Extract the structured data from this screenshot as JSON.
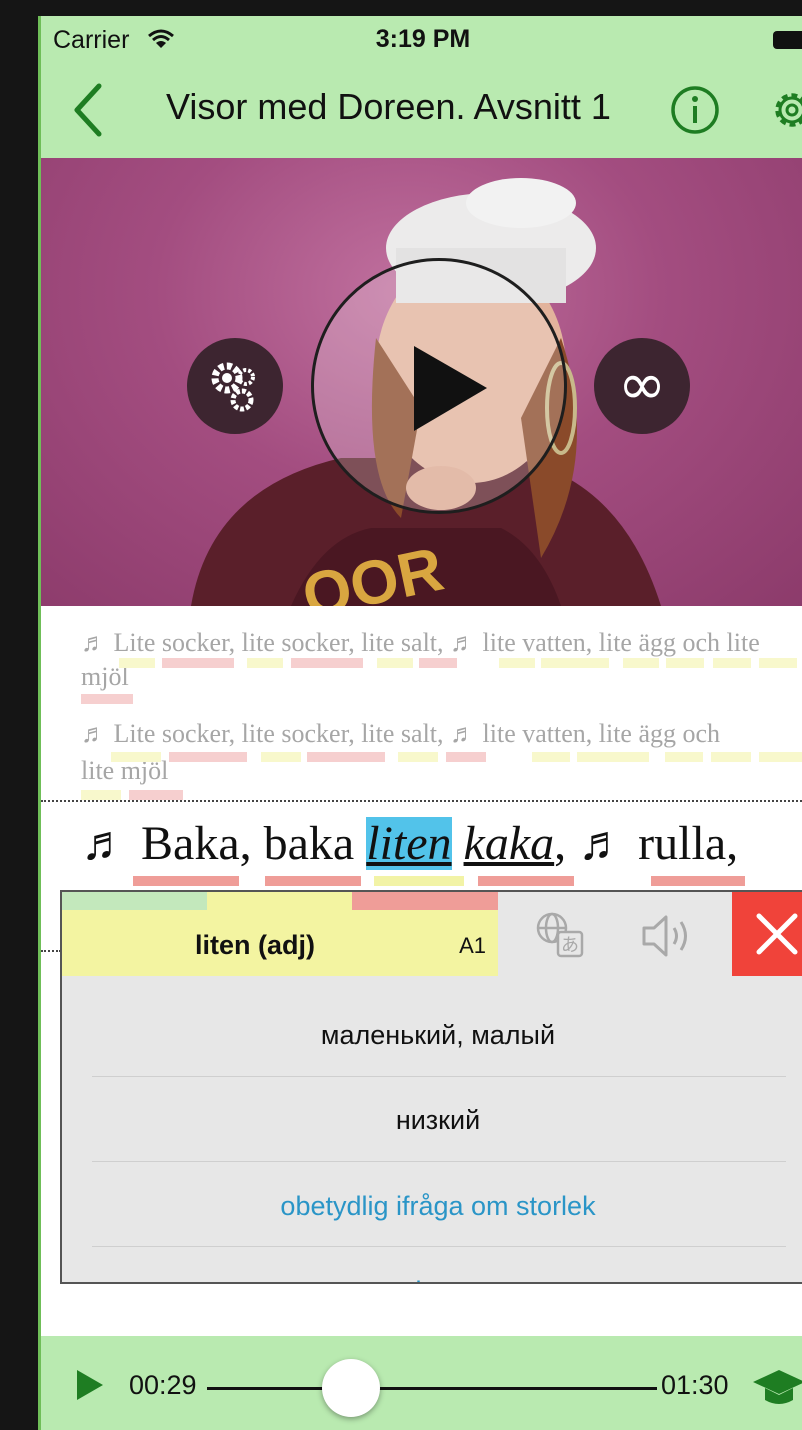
{
  "status_bar": {
    "carrier": "Carrier",
    "time": "3:19 PM"
  },
  "nav": {
    "title": "Visor med Doreen. Avsnitt 1"
  },
  "lyrics": {
    "line1": "♬ Lite socker, lite socker, lite salt, ♬ lite vatten, lite ägg och lite",
    "line1_wrap": "mjöl",
    "line2": "♬ Lite socker, lite socker, lite salt, ♬ lite vatten, lite ägg och",
    "line2_wrap": "lite mjöl",
    "active_parts": [
      "♬ Baka, baka ",
      "liten",
      " ",
      "kaka",
      ", ♬ rulla,"
    ]
  },
  "popup": {
    "word": "liten (adj)",
    "level": "A1",
    "meanings": [
      "маленький, малый",
      "низкий",
      "obetydlig ifråga om storlek",
      "kort"
    ],
    "meaning_colors": [
      "#111111",
      "#111111",
      "#2a95c7",
      "#2a95c7"
    ]
  },
  "player": {
    "current_time": "00:29",
    "total_time": "01:30",
    "progress": 0.32
  },
  "colors": {
    "bar_green": "#b9eab0",
    "icon_green": "#1e7d22",
    "close_red": "#f0433a",
    "word_highlight": "#52c3ea"
  }
}
